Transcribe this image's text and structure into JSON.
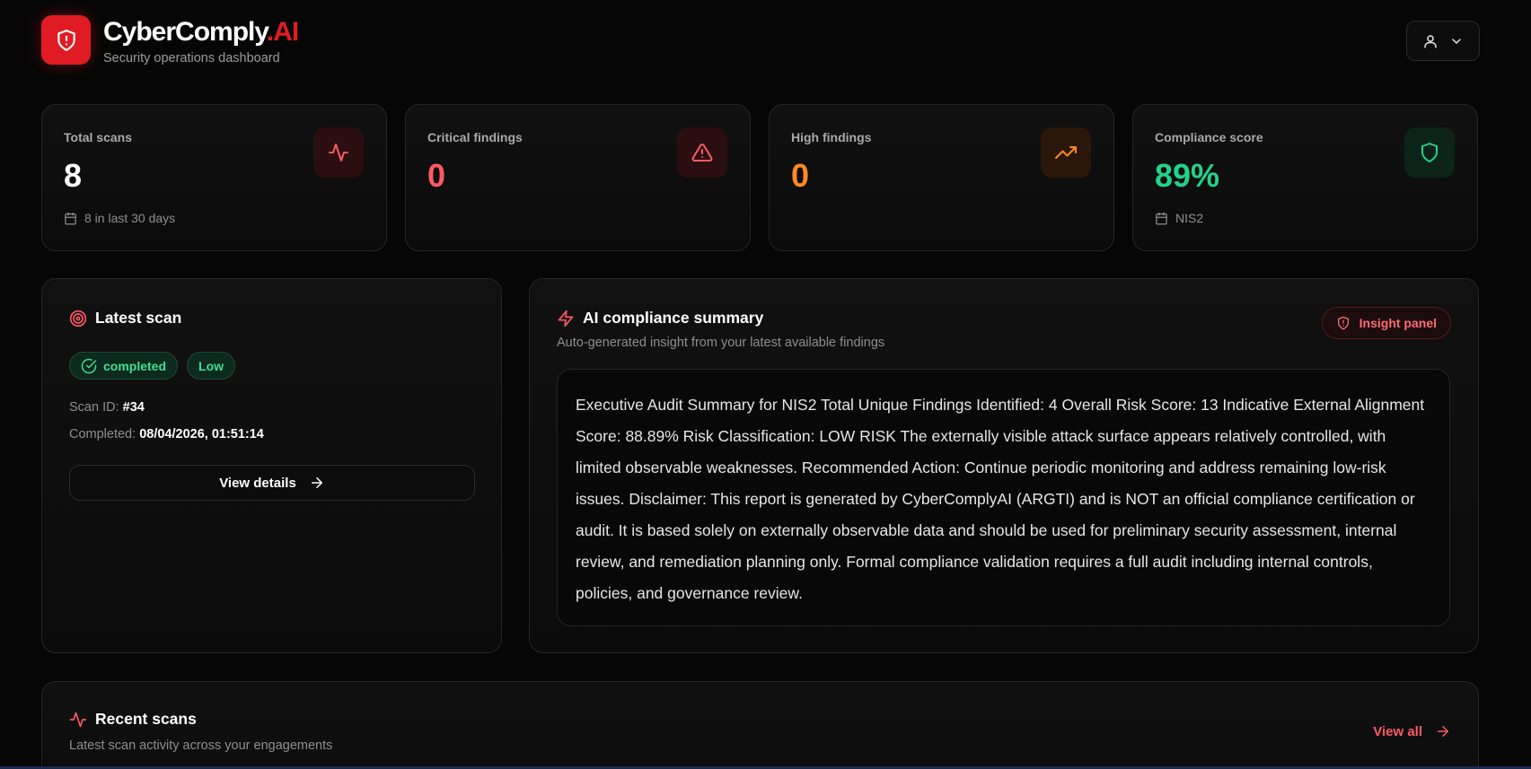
{
  "brand": {
    "name": "CyberComply",
    "suffix": ".AI",
    "subtitle": "Security operations dashboard"
  },
  "colors": {
    "accent": "#e11b23",
    "critical": "#ff5a63",
    "high": "#ff8a1f",
    "success": "#22d38a"
  },
  "user_menu": {
    "icons": [
      "user-icon",
      "chevron-down-icon"
    ]
  },
  "stats": [
    {
      "label": "Total scans",
      "value": "8",
      "foot": "8 in last 30 days",
      "icon": "activity-icon",
      "color": "#ffffff"
    },
    {
      "label": "Critical findings",
      "value": "0",
      "foot": "",
      "icon": "alert-triangle-icon",
      "color": "#ff5a63"
    },
    {
      "label": "High findings",
      "value": "0",
      "foot": "",
      "icon": "trending-up-icon",
      "color": "#ff8a1f"
    },
    {
      "label": "Compliance score",
      "value": "89%",
      "foot": "NIS2",
      "icon": "shield-icon",
      "color": "#22d38a"
    }
  ],
  "latest_scan": {
    "title": "Latest scan",
    "status": "completed",
    "severity": "Low",
    "scan_id_label": "Scan ID:",
    "scan_id": "#34",
    "completed_label": "Completed:",
    "completed": "08/04/2026, 01:51:14",
    "view_details": "View details"
  },
  "ai_summary": {
    "title": "AI compliance summary",
    "subtitle": "Auto-generated insight from your latest available findings",
    "insight_button": "Insight panel",
    "text": "Executive Audit Summary for NIS2 Total Unique Findings Identified: 4 Overall Risk Score: 13 Indicative External Alignment Score: 88.89% Risk Classification: LOW RISK The externally visible attack surface appears relatively controlled, with limited observable weaknesses. Recommended Action: Continue periodic monitoring and address remaining low-risk issues. Disclaimer: This report is generated by CyberComplyAI (ARGTI) and is NOT an official compliance certification or audit. It is based solely on externally observable data and should be used for preliminary security assessment, internal review, and remediation planning only. Formal compliance validation requires a full audit including internal controls, policies, and governance review."
  },
  "recent_scans": {
    "title": "Recent scans",
    "subtitle": "Latest scan activity across your engagements",
    "view_all": "View all"
  }
}
